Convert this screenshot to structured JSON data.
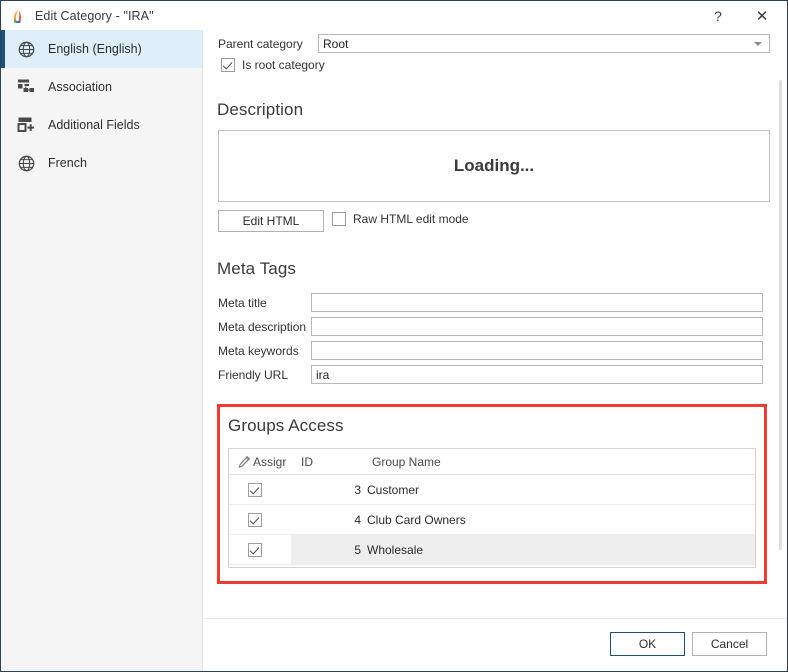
{
  "window": {
    "title": "Edit Category - \"IRA\"",
    "app_icon": "leaf-icon",
    "help_label": "?",
    "close_label": "✕",
    "accent_color": "#1f4e79",
    "highlight_color": "#ee3b33"
  },
  "sidebar": {
    "items": [
      {
        "label": "English (English)",
        "icon": "globe-icon",
        "selected": true
      },
      {
        "label": "Association",
        "icon": "association-icon",
        "selected": false
      },
      {
        "label": "Additional Fields",
        "icon": "additional-fields-icon",
        "selected": false
      },
      {
        "label": "French",
        "icon": "globe-icon",
        "selected": false
      }
    ]
  },
  "form": {
    "parent_category": {
      "label": "Parent category",
      "value": "Root"
    },
    "is_root_category": {
      "label": "Is root category",
      "checked": true
    }
  },
  "description": {
    "title": "Description",
    "editor_content": "Loading...",
    "edit_html_label": "Edit HTML",
    "raw_html_label": "Raw HTML edit mode",
    "raw_html_checked": false
  },
  "meta_tags": {
    "title": "Meta Tags",
    "fields": [
      {
        "label": "Meta title",
        "value": ""
      },
      {
        "label": "Meta description",
        "value": ""
      },
      {
        "label": "Meta keywords",
        "value": ""
      },
      {
        "label": "Friendly URL",
        "value": "ira"
      }
    ]
  },
  "groups_access": {
    "title": "Groups Access",
    "columns": {
      "pencil_icon": "pencil-icon",
      "assign": "Assigr",
      "id": "ID",
      "group_name": "Group Name"
    },
    "rows": [
      {
        "assigned": true,
        "id": "3",
        "name": "Customer",
        "selected": false
      },
      {
        "assigned": true,
        "id": "4",
        "name": "Club Card Owners",
        "selected": false
      },
      {
        "assigned": true,
        "id": "5",
        "name": "Wholesale",
        "selected": true
      }
    ]
  },
  "footer": {
    "ok_label": "OK",
    "cancel_label": "Cancel"
  }
}
